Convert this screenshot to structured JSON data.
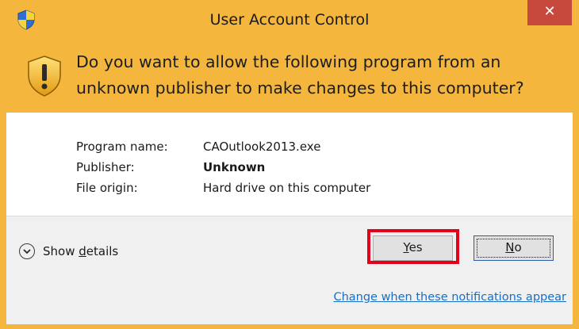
{
  "window": {
    "title": "User Account Control",
    "close_glyph": "✕"
  },
  "header": {
    "question": "Do you want to allow the following program from an unknown publisher to make changes to this computer?"
  },
  "info": {
    "program_name_label": "Program name:",
    "program_name_value": "CAOutlook2013.exe",
    "publisher_label": "Publisher:",
    "publisher_value": "Unknown",
    "file_origin_label": "File origin:",
    "file_origin_value": "Hard drive on this computer"
  },
  "footer": {
    "details_pre": "Show ",
    "details_mnemonic": "d",
    "details_post": "etails",
    "yes_mnemonic": "Y",
    "yes_rest": "es",
    "no_mnemonic": "N",
    "no_rest": "o",
    "change_link": "Change when these notifications appear"
  },
  "colors": {
    "banner": "#f4b63c",
    "close_button": "#c7483d",
    "highlight_box": "#e2001a",
    "link": "#1a6fc4"
  },
  "icons": {
    "title": "uac-shield-icon",
    "warning": "warning-shield-icon",
    "details": "chevron-down-circle-icon"
  }
}
